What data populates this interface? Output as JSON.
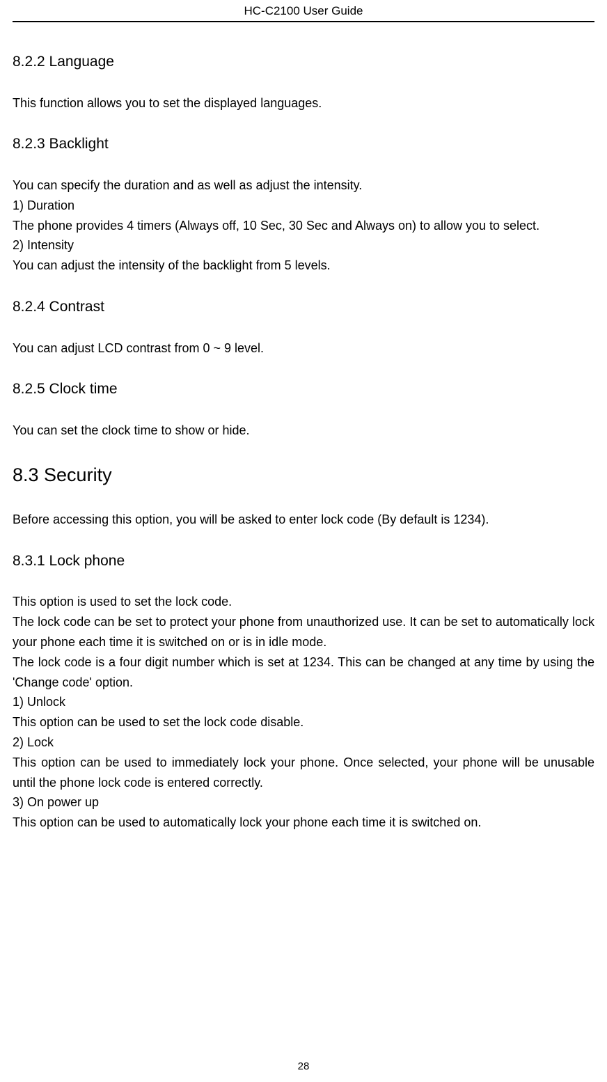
{
  "header": {
    "title": "HC-C2100 User Guide"
  },
  "sections": {
    "s822": {
      "heading": "8.2.2 Language",
      "body": "This function allows you to set the displayed languages."
    },
    "s823": {
      "heading": "8.2.3 Backlight",
      "intro": "You can specify the duration and as well as adjust the intensity.",
      "item1_label": "1)    Duration",
      "item1_body": "The phone provides 4 timers (Always off, 10 Sec, 30 Sec and Always on) to allow you to select.",
      "item2_label": "2)    Intensity",
      "item2_body": "You can adjust the intensity of the backlight from 5 levels."
    },
    "s824": {
      "heading": "8.2.4 Contrast",
      "body": "You can adjust LCD contrast from 0 ~ 9 level."
    },
    "s825": {
      "heading": "8.2.5 Clock time",
      "body": "You can set the clock time to show or hide."
    },
    "s83": {
      "heading": "8.3 Security",
      "body": "Before accessing this option, you will be asked to enter lock code (By default is 1234)."
    },
    "s831": {
      "heading": "8.3.1 Lock phone",
      "p1": "This option is used to set the lock code.",
      "p2": "The lock code can be set to protect your phone from unauthorized use. It can be set to automatically lock your phone each time it is switched on or is in idle mode.",
      "p3": "The lock code is a four digit number which is set at 1234. This can be changed at any time by using the 'Change code' option.",
      "item1_label": "1)    Unlock",
      "item1_body": "This option can be used to set the lock code disable.",
      "item2_label": "2)    Lock",
      "item2_body": "This option can be used to immediately lock your phone. Once selected, your phone will be unusable until the phone lock code is entered correctly.",
      "item3_label": "3)    On power up",
      "item3_body": "This option can be used to automatically lock your phone each time it is switched on."
    }
  },
  "footer": {
    "page_number": "28"
  }
}
